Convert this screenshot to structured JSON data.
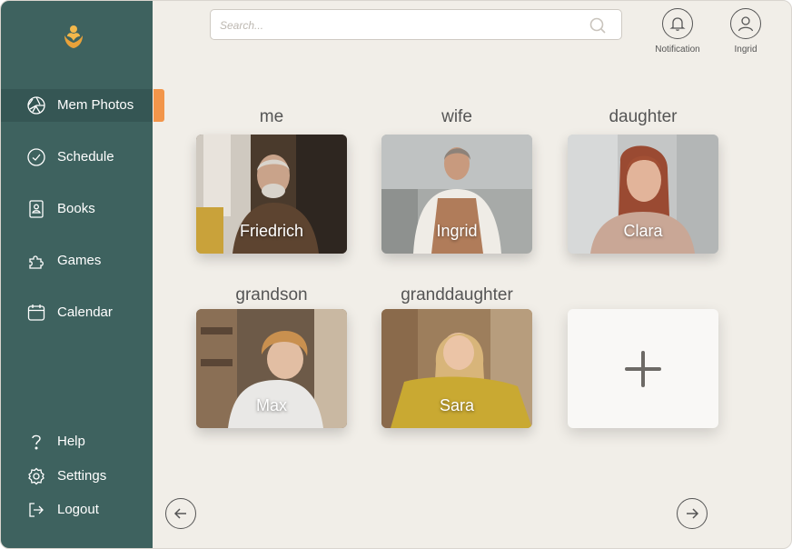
{
  "sidebar": {
    "logo": "flower-hands-logo",
    "items": [
      {
        "label": "Mem Photos",
        "icon": "aperture-icon",
        "active": true
      },
      {
        "label": "Schedule",
        "icon": "check-circle-icon"
      },
      {
        "label": "Books",
        "icon": "book-icon"
      },
      {
        "label": "Games",
        "icon": "puzzle-icon"
      },
      {
        "label": "Calendar",
        "icon": "calendar-icon"
      }
    ],
    "bottom": [
      {
        "label": "Help",
        "icon": "question-icon"
      },
      {
        "label": "Settings",
        "icon": "gear-icon"
      },
      {
        "label": "Logout",
        "icon": "logout-icon"
      }
    ]
  },
  "search": {
    "placeholder": "Search..."
  },
  "header": {
    "notification_label": "Notification",
    "user_label": "Ingrid"
  },
  "grid": {
    "cards": [
      {
        "title": "me",
        "name": "Friedrich"
      },
      {
        "title": "wife",
        "name": "Ingrid"
      },
      {
        "title": "daughter",
        "name": "Clara"
      },
      {
        "title": "grandson",
        "name": "Max"
      },
      {
        "title": "granddaughter",
        "name": "Sara"
      }
    ],
    "add_icon": "plus-icon"
  },
  "colors": {
    "sidebar": "#3e625f",
    "accent": "#f2954a",
    "background": "#f1eee8"
  }
}
